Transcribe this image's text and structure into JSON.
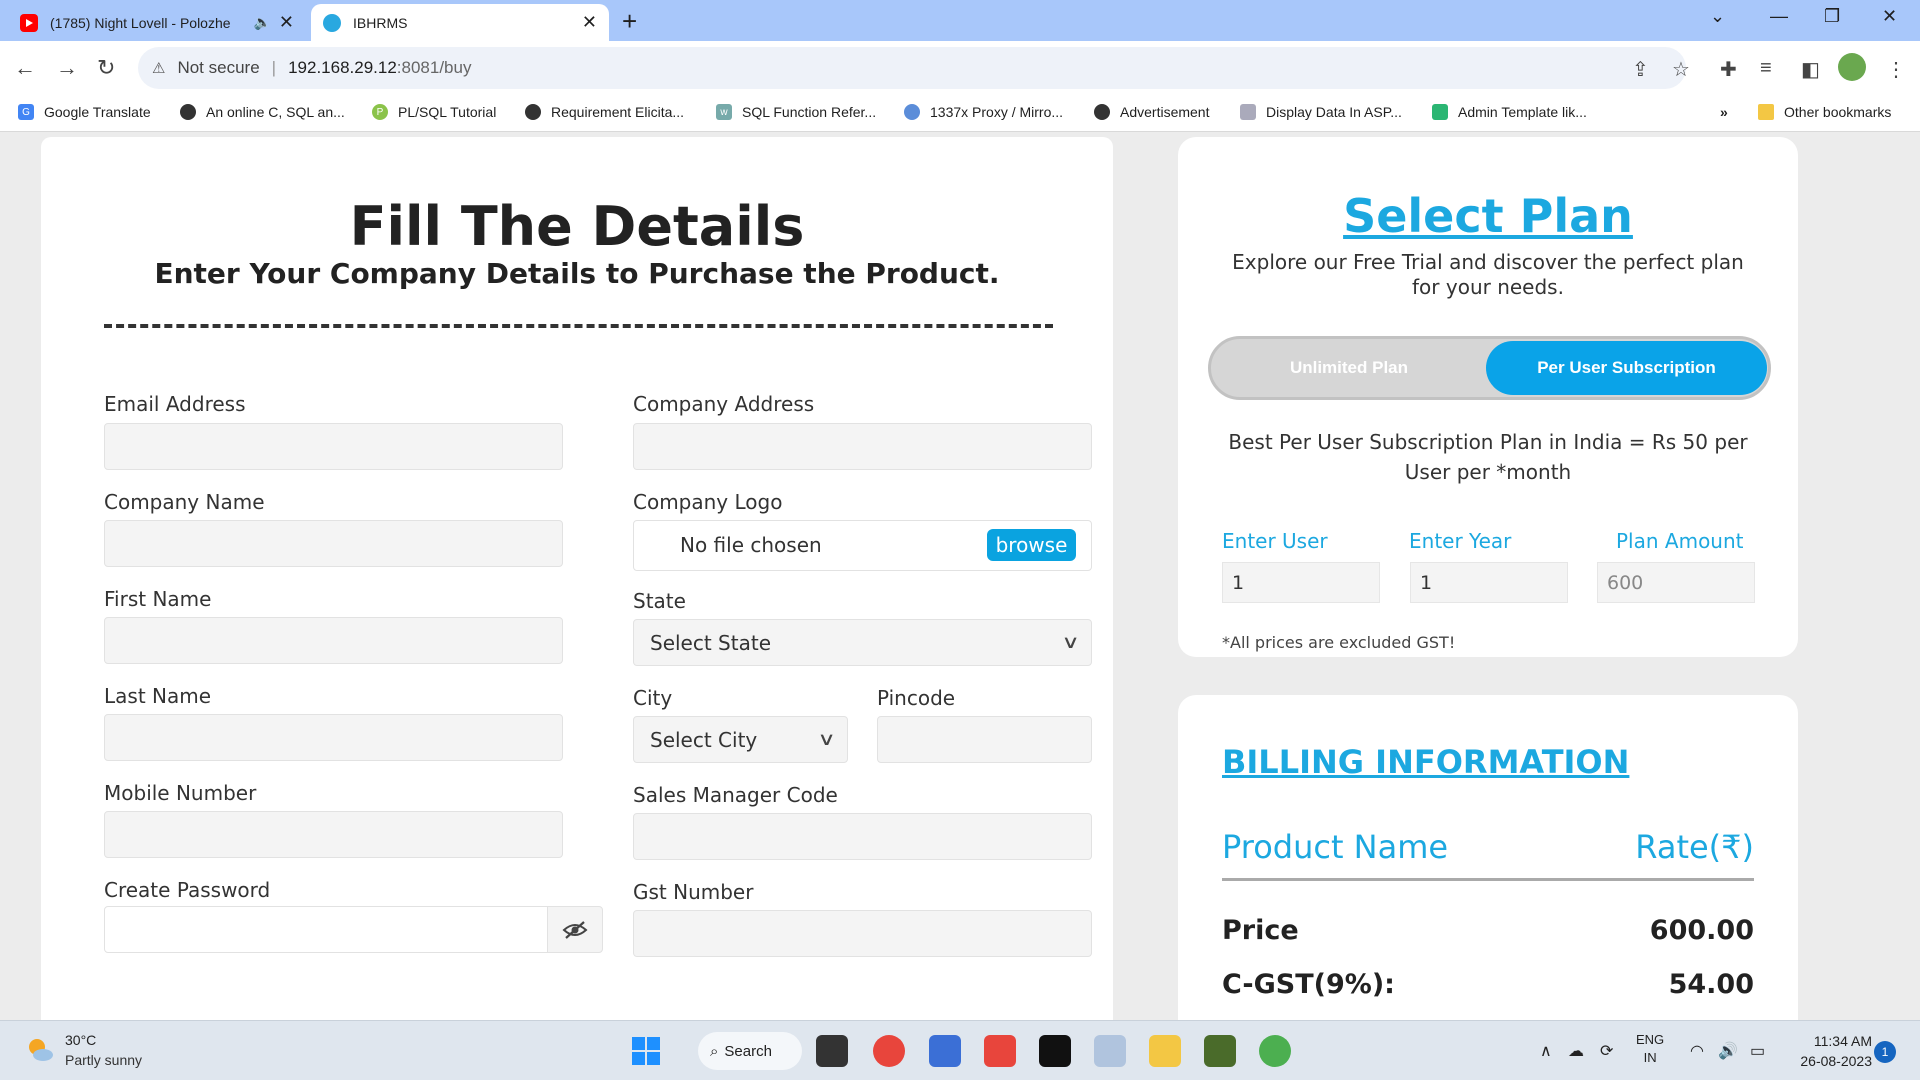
{
  "browser": {
    "tabs": [
      {
        "title": "(1785) Night Lovell - Polozhe",
        "audio_icon": "speaker-icon"
      },
      {
        "title": "IBHRMS"
      }
    ],
    "security_label": "Not secure",
    "url_host": "192.168.29.12",
    "url_path": ":8081/buy",
    "bookmarks": [
      "Google Translate",
      "An online C, SQL an...",
      "PL/SQL Tutorial",
      "Requirement Elicita...",
      "SQL Function Refer...",
      "1337x Proxy / Mirro...",
      "Advertisement",
      "Display Data In ASP...",
      "Admin Template lik..."
    ],
    "more_bookmarks": "»",
    "other_bookmarks": "Other bookmarks"
  },
  "form": {
    "title": "Fill The Details",
    "subtitle": "Enter Your Company Details to Purchase the Product.",
    "labels": {
      "email": "Email Address",
      "company_name": "Company Name",
      "first_name": "First Name",
      "last_name": "Last Name",
      "mobile": "Mobile Number",
      "password": "Create Password",
      "company_address": "Company Address",
      "company_logo": "Company Logo",
      "state": "State",
      "city": "City",
      "pincode": "Pincode",
      "sales_manager": "Sales Manager Code",
      "gst": "Gst Number"
    },
    "file_status": "No file chosen",
    "browse_label": "browse",
    "state_selected": "Select State",
    "city_selected": "Select City"
  },
  "plan": {
    "title": "Select Plan",
    "description": "Explore our Free Trial and discover the perfect plan for your needs.",
    "toggle": {
      "option1": "Unlimited Plan",
      "option2": "Per User Subscription",
      "selected": "Per User Subscription"
    },
    "info": "Best Per User Subscription Plan in India = Rs 50 per User per *month",
    "enter_user_label": "Enter User",
    "enter_year_label": "Enter Year",
    "plan_amount_label": "Plan Amount",
    "enter_user_value": "1",
    "enter_year_value": "1",
    "plan_amount_value": "600",
    "gst_note": "*All prices are excluded GST!"
  },
  "billing": {
    "title": "BILLING INFORMATION",
    "col_product": "Product Name",
    "col_rate": "Rate(₹)",
    "rows": [
      {
        "label": "Price",
        "value": "600.00"
      },
      {
        "label": "C-GST(9%):",
        "value": "54.00"
      }
    ]
  },
  "taskbar": {
    "temperature": "30°C",
    "weather": "Partly sunny",
    "search_label": "Search",
    "lang_top": "ENG",
    "lang_bottom": "IN",
    "time": "11:34 AM",
    "date": "26-08-2023",
    "notification_count": "1"
  },
  "colors": {
    "accent": "#1ca8e0",
    "toggle_active": "#0aa3e8",
    "tab_strip": "#a8c7fa"
  }
}
